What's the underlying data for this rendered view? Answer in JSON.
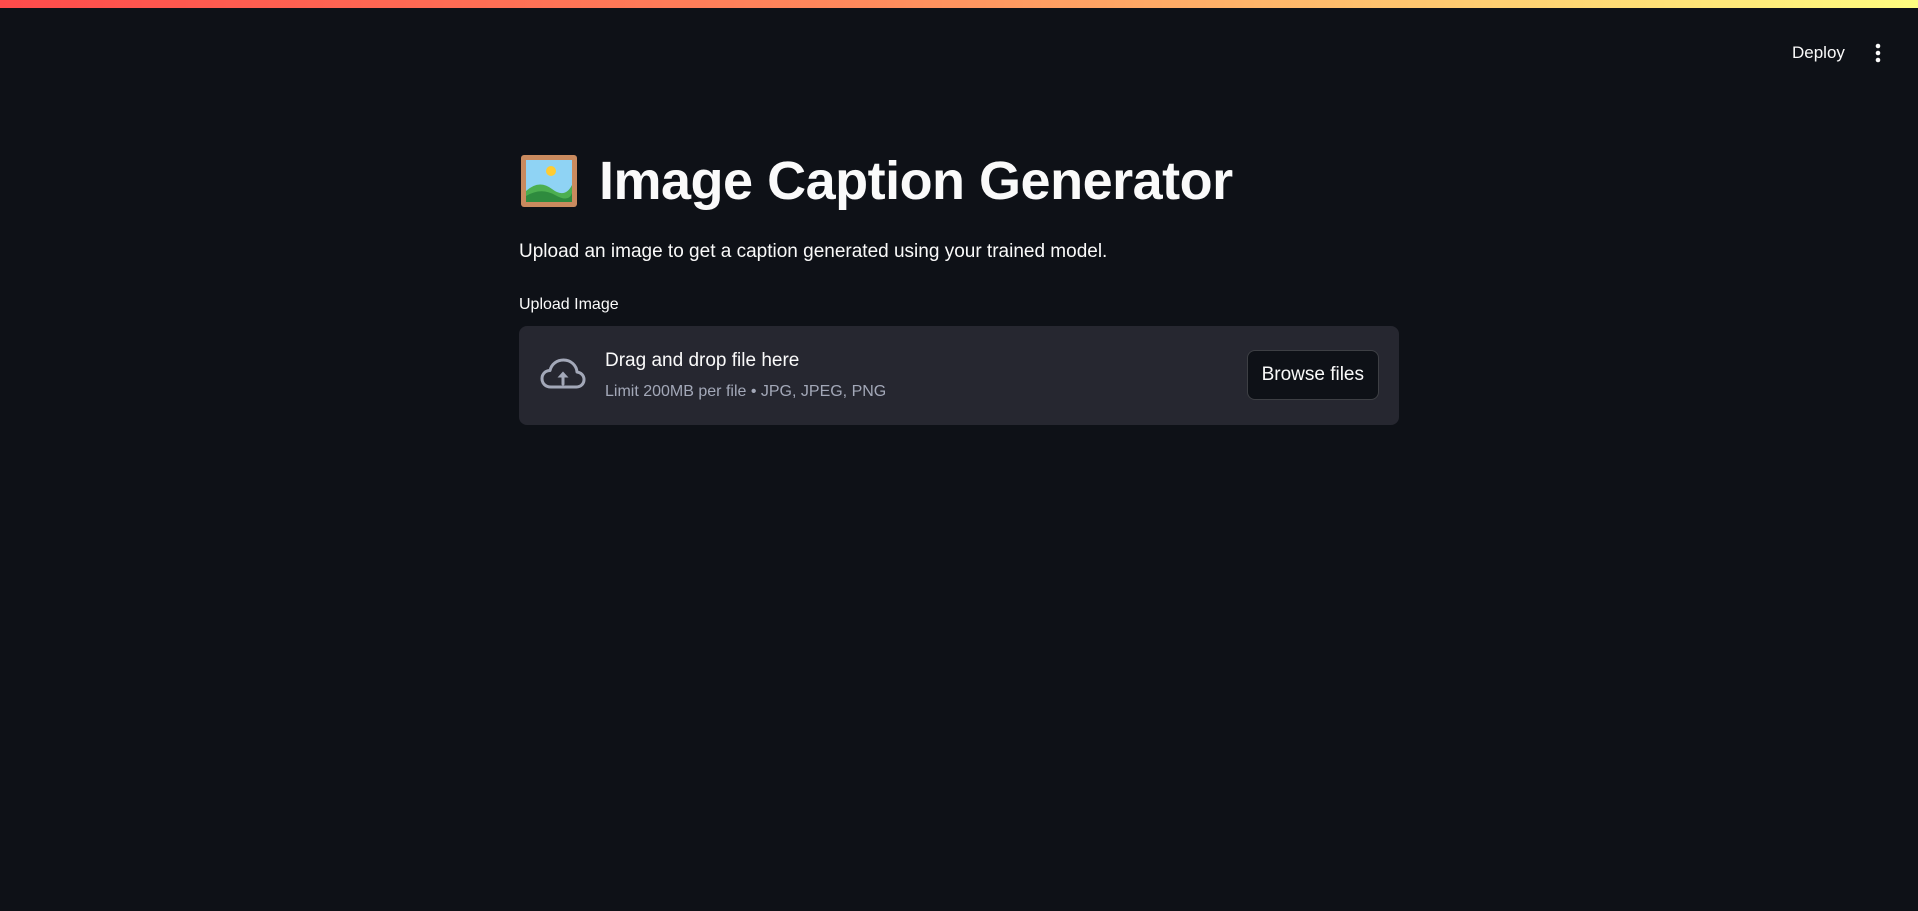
{
  "header": {
    "deploy_label": "Deploy",
    "menu_icon": "vertical-ellipsis-icon"
  },
  "main": {
    "title_icon": "framed-picture-icon",
    "title": "Image Caption Generator",
    "subtitle": "Upload an image to get a caption generated using your trained model.",
    "uploader": {
      "label": "Upload Image",
      "icon": "cloud-upload-icon",
      "drop_text": "Drag and drop file here",
      "limit_text": "Limit 200MB per file • JPG, JPEG, PNG",
      "browse_label": "Browse files"
    }
  },
  "colors": {
    "background": "#0e1117",
    "dropzone": "#262730",
    "text": "#fafafa",
    "muted_text": "#a3a8b8",
    "accent_gradient_start": "#ff4b4b",
    "accent_gradient_end": "#fffd80"
  }
}
